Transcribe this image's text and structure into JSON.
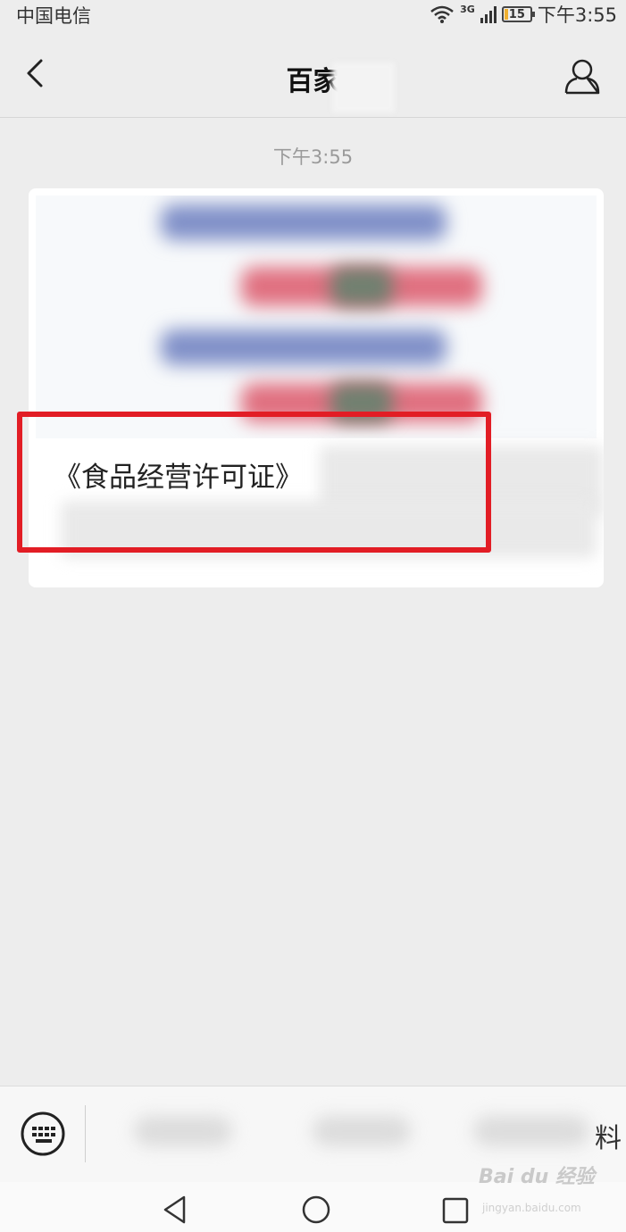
{
  "status_bar": {
    "carrier": "中国电信",
    "network": "3G",
    "battery": "15",
    "battery_level": 0.15,
    "time": "下午3:55"
  },
  "nav": {
    "title": "百家",
    "back_icon": "chevron-left-icon",
    "profile_icon": "person-icon"
  },
  "chat": {
    "timestamp": "下午3:55",
    "card": {
      "title": "《食品经营许可证》"
    }
  },
  "bottom": {
    "keyboard_icon": "keyboard-icon",
    "menu_tail": "料"
  },
  "watermark": {
    "brand": "Bai du 经验",
    "url": "jingyan.baidu.com"
  },
  "colors": {
    "background": "#ededed",
    "highlight": "#e21d25"
  }
}
